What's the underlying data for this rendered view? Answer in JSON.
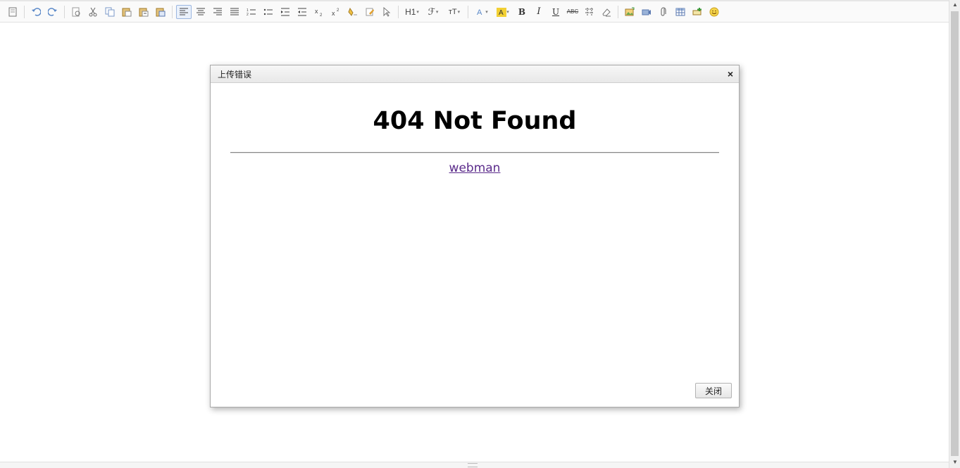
{
  "toolbar": {
    "buttons": [
      {
        "icon": "source-icon"
      },
      {
        "icon": "undo-icon"
      },
      {
        "icon": "redo-icon"
      },
      {
        "icon": "preview-icon"
      },
      {
        "icon": "cut-icon"
      },
      {
        "icon": "copy-icon"
      },
      {
        "icon": "paste-icon"
      },
      {
        "icon": "paste-plain-icon"
      },
      {
        "icon": "paste-word-icon"
      },
      {
        "icon": "align-left-icon"
      },
      {
        "icon": "align-center-icon"
      },
      {
        "icon": "align-right-icon"
      },
      {
        "icon": "justify-icon"
      },
      {
        "icon": "ordered-list-icon"
      },
      {
        "icon": "unordered-list-icon"
      },
      {
        "icon": "indent-icon"
      },
      {
        "icon": "outdent-icon"
      },
      {
        "icon": "subscript-icon"
      },
      {
        "icon": "superscript-icon"
      },
      {
        "icon": "clear-format-icon"
      },
      {
        "icon": "format-brush-icon"
      },
      {
        "icon": "select-all-icon"
      }
    ],
    "heading_label": "H1",
    "font_label": "ℱ",
    "size_label": "ᴛT",
    "bold_label": "B",
    "italic_label": "I",
    "underline_label": "U",
    "strike_label": "ABC"
  },
  "dialog": {
    "title": "上传错误",
    "close_glyph": "×",
    "heading": "404 Not Found",
    "link_text": "webman",
    "close_button": "关闭"
  }
}
